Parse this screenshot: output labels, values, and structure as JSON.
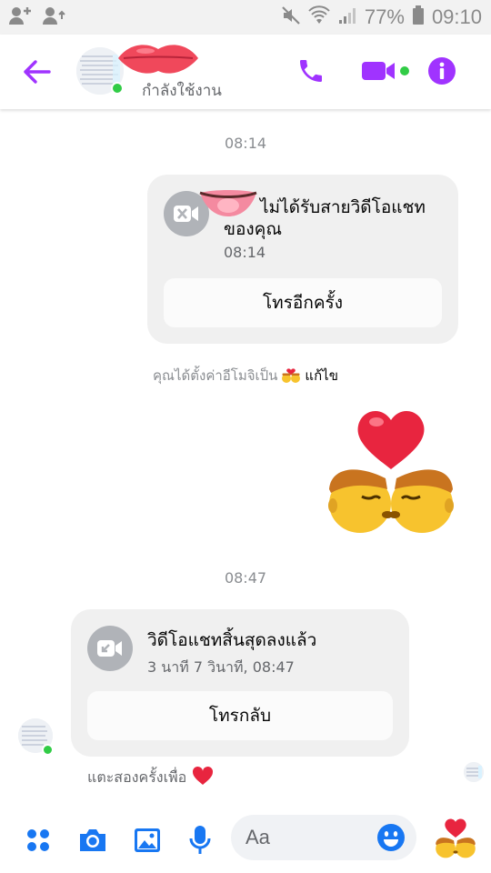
{
  "status_bar": {
    "battery": "77%",
    "time": "09:10"
  },
  "header": {
    "contact_status": "กำลังใช้งาน"
  },
  "thread": {
    "timestamp_1": "08:14",
    "missed_call": {
      "title_line1": "ไม่ได้รับสายวิดีโอแชท",
      "title_line2": "ของคุณ",
      "time": "08:14",
      "button_label": "โทรอีกครั้ง"
    },
    "emoji_change": {
      "text": "คุณได้ตั้งค่าอีโมจิเป็น",
      "edit_label": "แก้ไข"
    },
    "timestamp_2": "08:47",
    "ended_call": {
      "title": "วิดีโอแชทสิ้นสุดลงแล้ว",
      "detail": "3 นาที 7 วินาที, 08:47",
      "button_label": "โทรกลับ"
    },
    "double_tap_hint": "แตะสองครั้งเพื่อ"
  },
  "composer": {
    "placeholder": "Aa"
  },
  "colors": {
    "accent": "#a033ff",
    "emoji_blue": "#1877f2",
    "online": "#31cc46"
  }
}
